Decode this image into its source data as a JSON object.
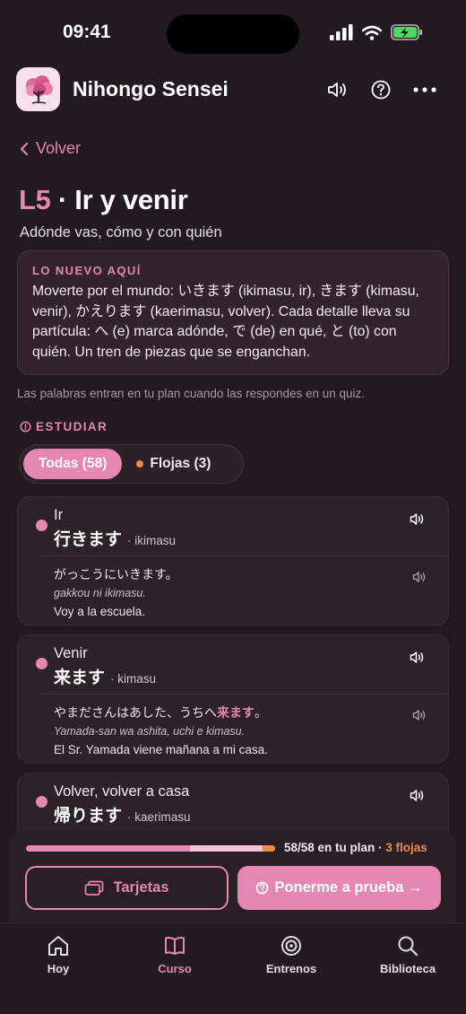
{
  "status": {
    "time": "09:41"
  },
  "app": {
    "title": "Nihongo Sensei"
  },
  "nav": {
    "back_label": "Volver"
  },
  "lesson": {
    "number": "L5",
    "separator": "·",
    "title": "Ir y venir",
    "subtitle": "Adónde vas, cómo y con quién"
  },
  "new_box": {
    "label": "LO NUEVO AQUÍ",
    "text": "Moverte por el mundo: いきます (ikimasu, ir), きます (kimasu, venir), かえります (kaerimasu, volver). Cada detalle lleva su partícula: へ (e) marca adónde, で (de) en qué, と (to) con quién. Un tren de piezas que se enganchan."
  },
  "hint": "Las palabras entran en tu plan cuando las respondes en un quiz.",
  "study": {
    "label": "ESTUDIAR",
    "filter_all": "Todas (58)",
    "filter_weak": "Flojas (3)"
  },
  "words": [
    {
      "meaning": "Ir",
      "jp": "行きます",
      "romaji": "· ikimasu",
      "example_jp": "がっこうにいきます。",
      "example_jp_pre": "",
      "example_jp_hl": "",
      "example_jp_post": "",
      "example_romaji": "gakkou ni ikimasu.",
      "example_tr": "Voy a la escuela."
    },
    {
      "meaning": "Venir",
      "jp": "来ます",
      "romaji": "· kimasu",
      "example_jp_pre": "やまださんはあした、うちへ",
      "example_jp_hl": "来ます",
      "example_jp_post": "。",
      "example_romaji": "Yamada-san wa ashita, uchi e kimasu.",
      "example_tr": "El Sr. Yamada viene mañana a mi casa."
    },
    {
      "meaning": "Volver, volver a casa",
      "jp": "帰ります",
      "romaji": "· kaerimasu"
    }
  ],
  "plan": {
    "progress_main": 0.66,
    "progress_light": 0.29,
    "progress_weak": 0.05,
    "summary": "58/58 en tu plan · ",
    "weak": "3 flojas"
  },
  "actions": {
    "cards_label": "Tarjetas",
    "quiz_label": "Ponerme a prueba →"
  },
  "tabs": [
    {
      "label": "Hoy",
      "icon": "home-icon"
    },
    {
      "label": "Curso",
      "icon": "book-icon"
    },
    {
      "label": "Entrenos",
      "icon": "target-icon"
    },
    {
      "label": "Biblioteca",
      "icon": "search-icon"
    }
  ],
  "colors": {
    "accent": "#e487b3",
    "weak": "#f08a46",
    "background": "#221a20"
  }
}
